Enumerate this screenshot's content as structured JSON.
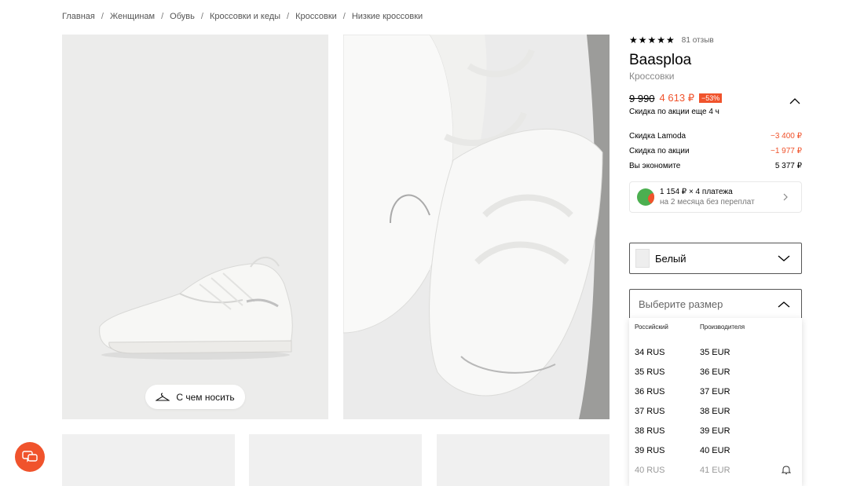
{
  "breadcrumbs": [
    "Главная",
    "Женщинам",
    "Обувь",
    "Кроссовки и кеды",
    "Кроссовки",
    "Низкие кроссовки"
  ],
  "gallery": {
    "wear_button_label": "С чем носить"
  },
  "product": {
    "stars": "★★★★★",
    "reviews_count": "81 отзыв",
    "brand": "Baasploa",
    "category": "Кроссовки",
    "old_price": "9 990",
    "new_price": "4 613 ₽",
    "discount_badge": "−53%",
    "promo_note": "Скидка по акции еще 4 ч",
    "breakdown": [
      {
        "label": "Скидка Lamoda",
        "value": "−3 400 ₽",
        "negative": true
      },
      {
        "label": "Скидка по акции",
        "value": "−1 977 ₽",
        "negative": true
      },
      {
        "label": "Вы экономите",
        "value": "5 377 ₽",
        "negative": false
      }
    ],
    "split": {
      "title": "1 154 ₽ × 4 платежа",
      "subtitle": "на 2 месяца без переплат"
    },
    "color": {
      "selected": "Белый"
    },
    "size": {
      "placeholder": "Выберите размер",
      "col_ru": "Российский",
      "col_maker": "Производителя",
      "rows": [
        {
          "ru": "34 RUS",
          "eu": "35 EUR",
          "available": true
        },
        {
          "ru": "35 RUS",
          "eu": "36 EUR",
          "available": true
        },
        {
          "ru": "36 RUS",
          "eu": "37 EUR",
          "available": true
        },
        {
          "ru": "37 RUS",
          "eu": "38 EUR",
          "available": true
        },
        {
          "ru": "38 RUS",
          "eu": "39 EUR",
          "available": true
        },
        {
          "ru": "39 RUS",
          "eu": "40 EUR",
          "available": true
        },
        {
          "ru": "40 RUS",
          "eu": "41 EUR",
          "available": false
        }
      ]
    }
  },
  "colors": {
    "accent": "#f0532c",
    "split_green": "#4caf50"
  },
  "icons": {
    "wear": "hanger-icon",
    "chat": "chat-icon",
    "collapse": "chevron-up-icon",
    "split_arrow": "chevron-right-icon",
    "color_caret": "chevron-down-icon",
    "size_caret": "chevron-up-icon",
    "notify": "bell-icon"
  }
}
